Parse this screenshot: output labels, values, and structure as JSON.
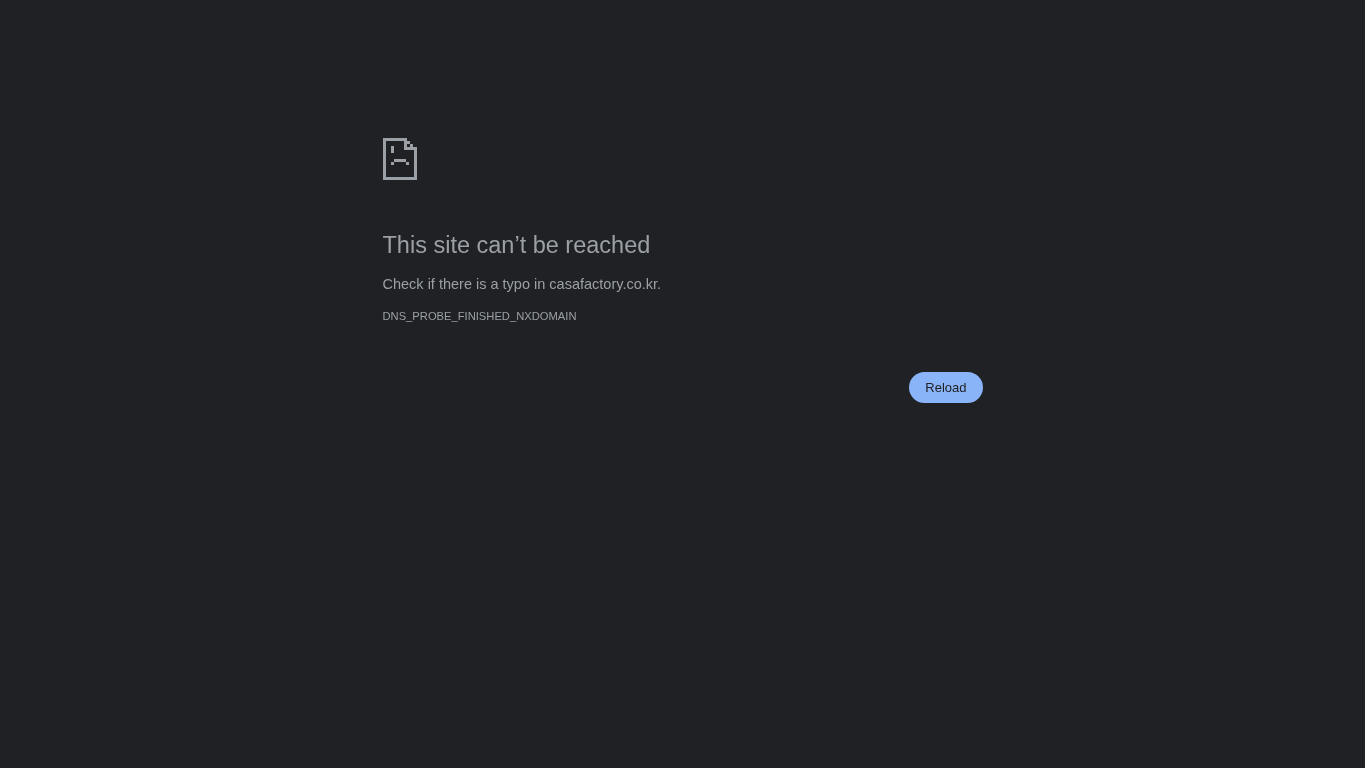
{
  "error": {
    "heading": "This site can’t be reached",
    "message": "Check if there is a typo in casafactory.co.kr.",
    "code": "DNS_PROBE_FINISHED_NXDOMAIN"
  },
  "buttons": [
    "Reload"
  ]
}
